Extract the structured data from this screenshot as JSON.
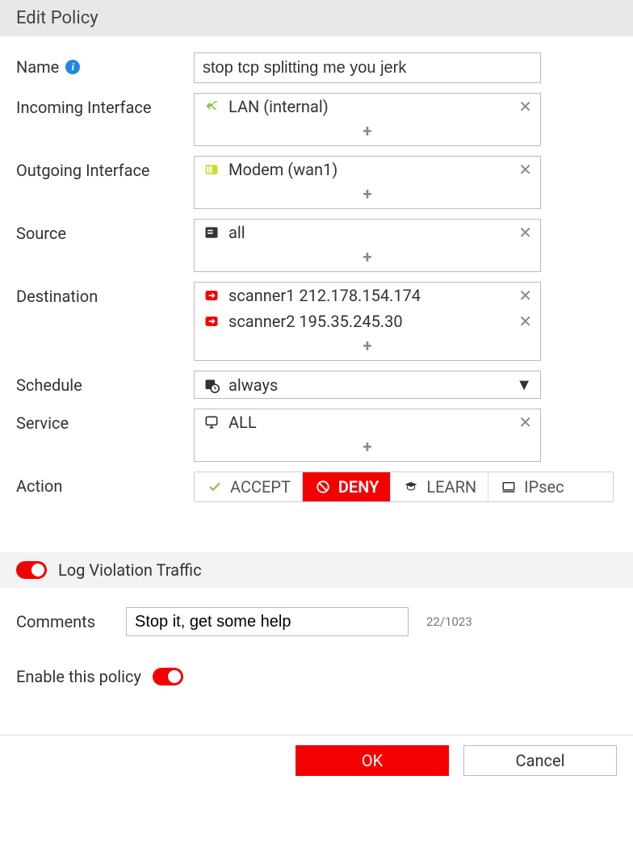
{
  "header": {
    "title": "Edit Policy"
  },
  "fields": {
    "name": {
      "label": "Name",
      "value": "stop tcp splitting me you jerk"
    },
    "incoming_interface": {
      "label": "Incoming Interface",
      "items": [
        {
          "label": "LAN (internal)",
          "icon": "shuffle-icon",
          "color": "#8BC34A"
        }
      ]
    },
    "outgoing_interface": {
      "label": "Outgoing Interface",
      "items": [
        {
          "label": "Modem (wan1)",
          "icon": "modem-icon",
          "color": "#CDDC39"
        }
      ]
    },
    "source": {
      "label": "Source",
      "items": [
        {
          "label": "all",
          "icon": "address-icon",
          "color": "#333"
        }
      ]
    },
    "destination": {
      "label": "Destination",
      "items": [
        {
          "label": "scanner1 212.178.154.174",
          "icon": "host-icon",
          "color": "#f40000"
        },
        {
          "label": "scanner2 195.35.245.30",
          "icon": "host-icon",
          "color": "#f40000"
        }
      ]
    },
    "schedule": {
      "label": "Schedule",
      "value": "always"
    },
    "service": {
      "label": "Service",
      "items": [
        {
          "label": "ALL",
          "icon": "service-icon",
          "color": "#333"
        }
      ]
    },
    "action": {
      "label": "Action",
      "options": [
        {
          "label": "ACCEPT",
          "icon": "check-icon"
        },
        {
          "label": "DENY",
          "icon": "deny-icon",
          "active": true
        },
        {
          "label": "LEARN",
          "icon": "learn-icon"
        },
        {
          "label": "IPsec",
          "icon": "ipsec-icon"
        }
      ]
    }
  },
  "log_toggle": {
    "label": "Log Violation Traffic",
    "on": true
  },
  "comments": {
    "label": "Comments",
    "value": "Stop it, get some help",
    "count": "22/1023"
  },
  "enable_policy": {
    "label": "Enable this policy",
    "on": true
  },
  "buttons": {
    "ok": "OK",
    "cancel": "Cancel"
  }
}
